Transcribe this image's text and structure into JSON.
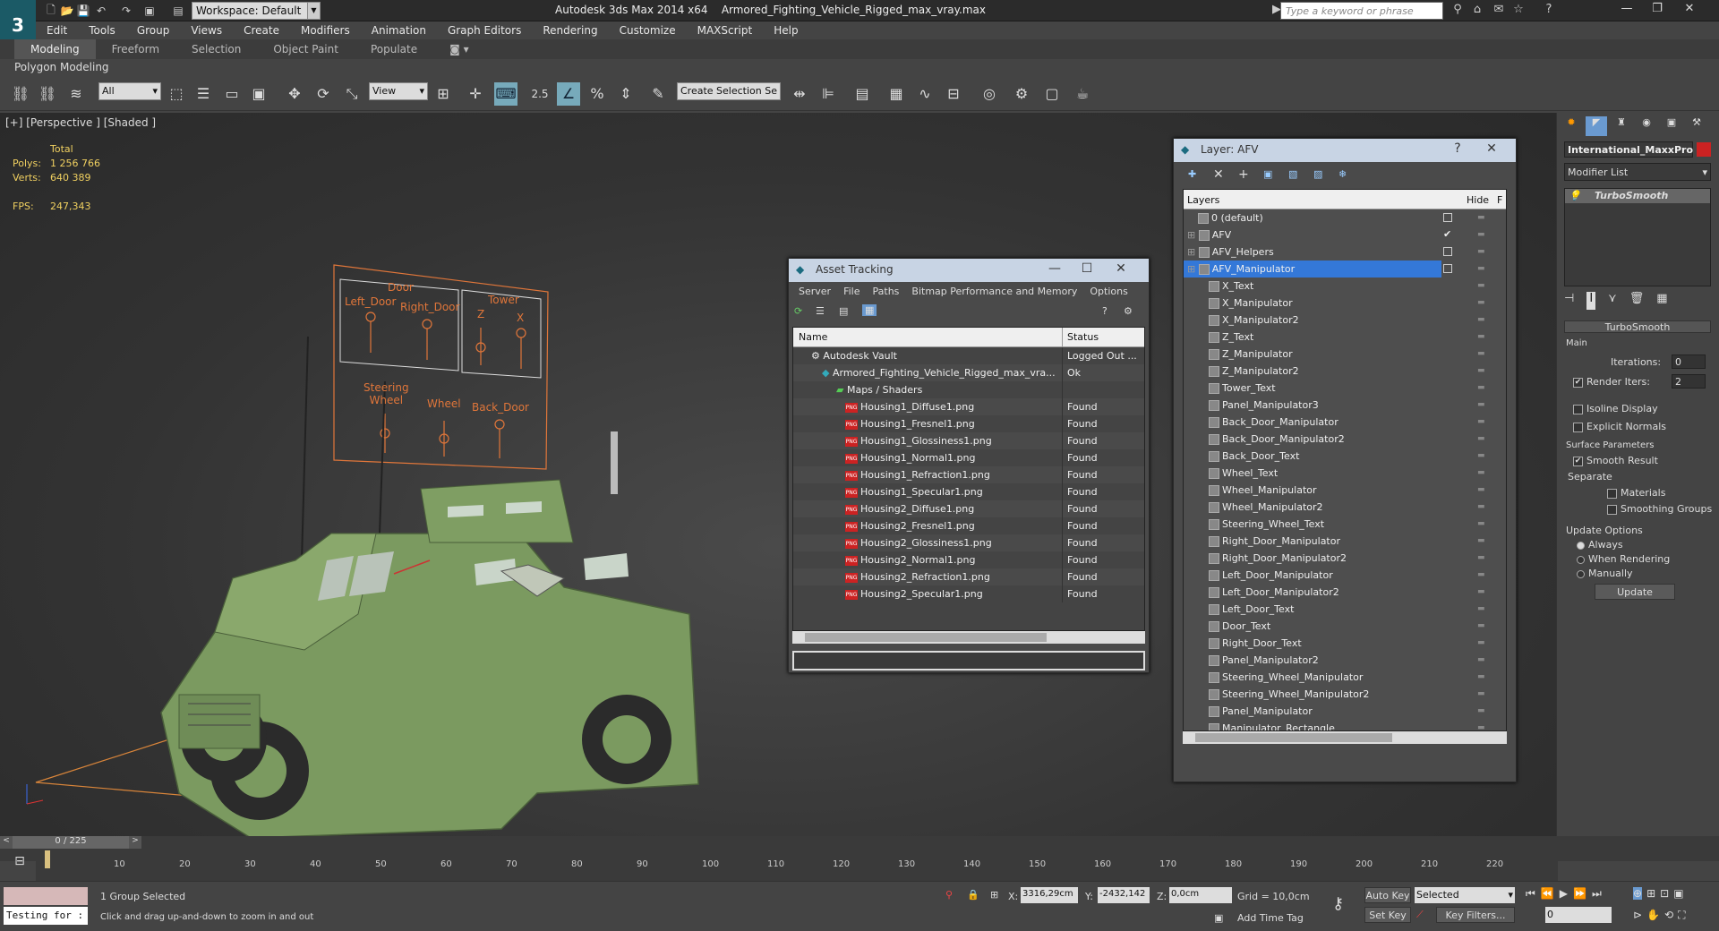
{
  "app": {
    "title": "Autodesk 3ds Max  2014 x64",
    "file": "Armored_Fighting_Vehicle_Rigged_max_vray.max",
    "workspace": "Workspace: Default",
    "search_placeholder": "Type a keyword or phrase"
  },
  "menu": [
    "Edit",
    "Tools",
    "Group",
    "Views",
    "Create",
    "Modifiers",
    "Animation",
    "Graph Editors",
    "Rendering",
    "Customize",
    "MAXScript",
    "Help"
  ],
  "ribbon": {
    "tabs": [
      "Modeling",
      "Freeform",
      "Selection",
      "Object Paint",
      "Populate"
    ],
    "sub": "Polygon Modeling"
  },
  "toolbar": {
    "filter": "All",
    "coord": "View",
    "selset": "Create Selection Se",
    "snap": "2.5"
  },
  "viewport": {
    "label": "[+] [Perspective ] [Shaded ]",
    "stats": {
      "total": "Total",
      "polys_label": "Polys:",
      "polys": "1 256 766",
      "verts_label": "Verts:",
      "verts": "640 389",
      "fps_label": "FPS:",
      "fps": "247,343"
    },
    "panel_labels": {
      "door": "Door",
      "left_door": "Left_Door",
      "right_door": "Right_Door",
      "tower": "Tower",
      "z": "Z",
      "x": "X",
      "steering": "Steering\nWheel",
      "wheel": "Wheel",
      "back_door": "Back_Door"
    }
  },
  "asset": {
    "title": "Asset Tracking",
    "menu": [
      "Server",
      "File",
      "Paths",
      "Bitmap Performance and Memory",
      "Options"
    ],
    "cols": [
      "Name",
      "Status"
    ],
    "rows": [
      {
        "name": "Autodesk Vault",
        "status": "Logged Out ..."
      },
      {
        "name": "Armored_Fighting_Vehicle_Rigged_max_vra...",
        "status": "Ok"
      },
      {
        "name": "Maps / Shaders",
        "status": ""
      },
      {
        "name": "Housing1_Diffuse1.png",
        "status": "Found"
      },
      {
        "name": "Housing1_Fresnel1.png",
        "status": "Found"
      },
      {
        "name": "Housing1_Glossiness1.png",
        "status": "Found"
      },
      {
        "name": "Housing1_Normal1.png",
        "status": "Found"
      },
      {
        "name": "Housing1_Refraction1.png",
        "status": "Found"
      },
      {
        "name": "Housing1_Specular1.png",
        "status": "Found"
      },
      {
        "name": "Housing2_Diffuse1.png",
        "status": "Found"
      },
      {
        "name": "Housing2_Fresnel1.png",
        "status": "Found"
      },
      {
        "name": "Housing2_Glossiness1.png",
        "status": "Found"
      },
      {
        "name": "Housing2_Normal1.png",
        "status": "Found"
      },
      {
        "name": "Housing2_Refraction1.png",
        "status": "Found"
      },
      {
        "name": "Housing2_Specular1.png",
        "status": "Found"
      }
    ]
  },
  "layer": {
    "title": "Layer: AFV",
    "col_layers": "Layers",
    "col_hide": "Hide",
    "col_f": "F",
    "top": [
      "0 (default)",
      "AFV",
      "AFV_Helpers",
      "AFV_Manipulator"
    ],
    "children": [
      "X_Text",
      "X_Manipulator",
      "X_Manipulator2",
      "Z_Text",
      "Z_Manipulator",
      "Z_Manipulator2",
      "Tower_Text",
      "Panel_Manipulator3",
      "Back_Door_Manipulator",
      "Back_Door_Manipulator2",
      "Back_Door_Text",
      "Wheel_Text",
      "Wheel_Manipulator",
      "Wheel_Manipulator2",
      "Steering_Wheel_Text",
      "Right_Door_Manipulator",
      "Right_Door_Manipulator2",
      "Left_Door_Manipulator",
      "Left_Door_Manipulator2",
      "Left_Door_Text",
      "Door_Text",
      "Right_Door_Text",
      "Panel_Manipulator2",
      "Steering_Wheel_Manipulator",
      "Steering_Wheel_Manipulator2",
      "Panel_Manipulator",
      "Manipulator_Rectangle"
    ]
  },
  "cmd": {
    "object": "International_MaxxPro",
    "modlist": "Modifier List",
    "stack": "TurboSmooth",
    "rollout": "TurboSmooth",
    "main": "Main",
    "iterations_label": "Iterations:",
    "iterations": "0",
    "render_iters_label": "Render Iters:",
    "render_iters": "2",
    "isoline": "Isoline Display",
    "explicit": "Explicit Normals",
    "surface": "Surface Parameters",
    "smooth": "Smooth Result",
    "separate": "Separate",
    "materials": "Materials",
    "smoothing": "Smoothing Groups",
    "update_opts": "Update Options",
    "always": "Always",
    "when_rendering": "When Rendering",
    "manually": "Manually",
    "update": "Update"
  },
  "timeline": {
    "frame": "0 / 225",
    "ticks": [
      "10",
      "20",
      "30",
      "40",
      "50",
      "60",
      "70",
      "80",
      "90",
      "100",
      "110",
      "120",
      "130",
      "140",
      "150",
      "160",
      "170",
      "180",
      "190",
      "200",
      "210",
      "220"
    ]
  },
  "status": {
    "script": "Testing for :",
    "selected": "1 Group Selected",
    "prompt": "Click and drag up-and-down to zoom in and out",
    "x_label": "X:",
    "x": "3316,29cm",
    "y_label": "Y:",
    "y": "-2432,142",
    "z_label": "Z:",
    "z": "0,0cm",
    "grid": "Grid = 10,0cm",
    "add_time_tag": "Add Time Tag",
    "auto_key": "Auto Key",
    "set_key": "Set Key",
    "selected_dd": "Selected",
    "key_filters": "Key Filters...",
    "frame_val": "0"
  }
}
